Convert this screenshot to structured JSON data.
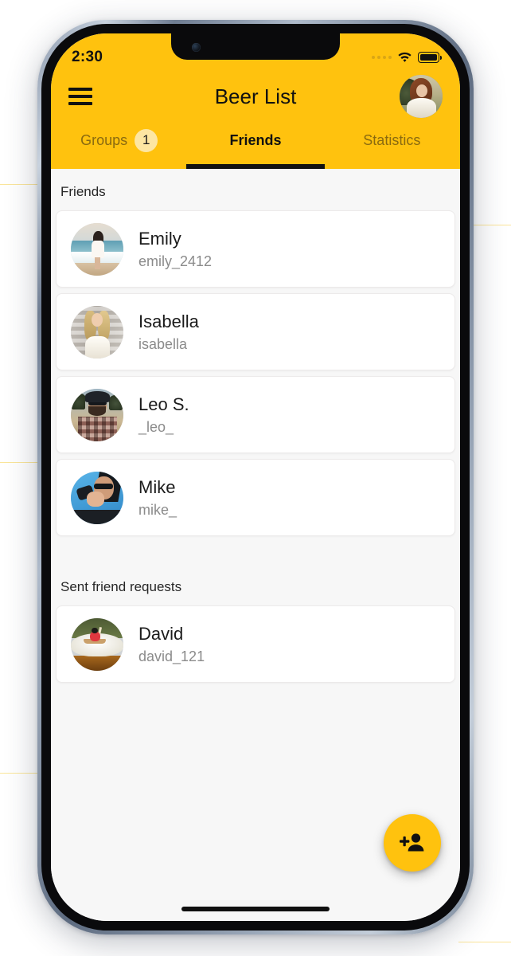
{
  "status_bar": {
    "time": "2:30",
    "signal_icon": "cellular-dots-icon",
    "wifi_icon": "wifi-icon",
    "battery_icon": "battery-full-icon"
  },
  "header": {
    "menu_icon": "hamburger-menu-icon",
    "title": "Beer List",
    "avatar_name": "user-profile-avatar",
    "bg_color": "#FFC20E"
  },
  "tabs": [
    {
      "label": "Groups",
      "badge": "1",
      "active": false
    },
    {
      "label": "Friends",
      "badge": "",
      "active": true
    },
    {
      "label": "Statistics",
      "badge": "",
      "active": false
    }
  ],
  "sections": [
    {
      "heading": "Friends",
      "items": [
        {
          "name": "Emily",
          "handle": "emily_2412",
          "avatar": "emily-avatar"
        },
        {
          "name": "Isabella",
          "handle": "isabella",
          "avatar": "isabella-avatar"
        },
        {
          "name": "Leo S.",
          "handle": "_leo_",
          "avatar": "leo-avatar"
        },
        {
          "name": "Mike",
          "handle": "mike_",
          "avatar": "mike-avatar"
        }
      ]
    },
    {
      "heading": "Sent friend requests",
      "items": [
        {
          "name": "David",
          "handle": "david_121",
          "avatar": "david-avatar"
        }
      ]
    }
  ],
  "fab": {
    "icon": "person-add-icon",
    "color": "#FFC20E"
  },
  "colors": {
    "accent": "#FFC20E",
    "badge": "#FDE6A2",
    "list_background": "#F7F7F7",
    "card_background": "#FFFFFF",
    "primary_text": "#1B1B1B",
    "secondary_text": "#8B8B8B",
    "inactive_tab_text": "#8A6A10"
  }
}
